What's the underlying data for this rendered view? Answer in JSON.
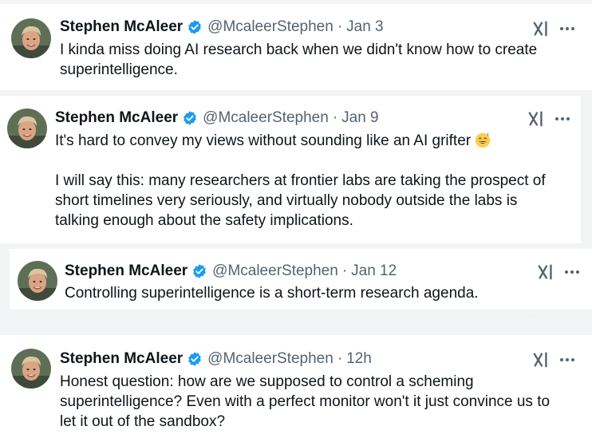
{
  "author": {
    "name": "Stephen McAleer",
    "handle": "@McaleerStephen",
    "verified_color": "#1d9bf0"
  },
  "icons": {
    "verified": "verified-badge-icon",
    "grok": "grok-icon",
    "more": "more-options-icon",
    "emoji": "grinning-face-with-sweat-emoji"
  },
  "tweets": [
    {
      "date": "Jan 3",
      "lines": [
        "I kinda miss doing AI research back when we didn't know how to create",
        "superintelligence."
      ]
    },
    {
      "date": "Jan 9",
      "para1": "It's hard to convey my views without sounding like an AI grifter",
      "para2_lines": [
        "I will say this: many researchers at frontier labs are taking the prospect of",
        "short timelines very seriously, and virtually nobody outside the labs is",
        "talking enough about the safety implications."
      ]
    },
    {
      "date": "Jan 12",
      "lines": [
        "Controlling superintelligence is a short-term research agenda."
      ]
    },
    {
      "date": "12h",
      "lines": [
        "Honest question: how are we supposed to control a scheming",
        "superintelligence? Even with a perfect monitor won't it just convince us to",
        "let it out of the sandbox?"
      ]
    }
  ],
  "separator": "·"
}
